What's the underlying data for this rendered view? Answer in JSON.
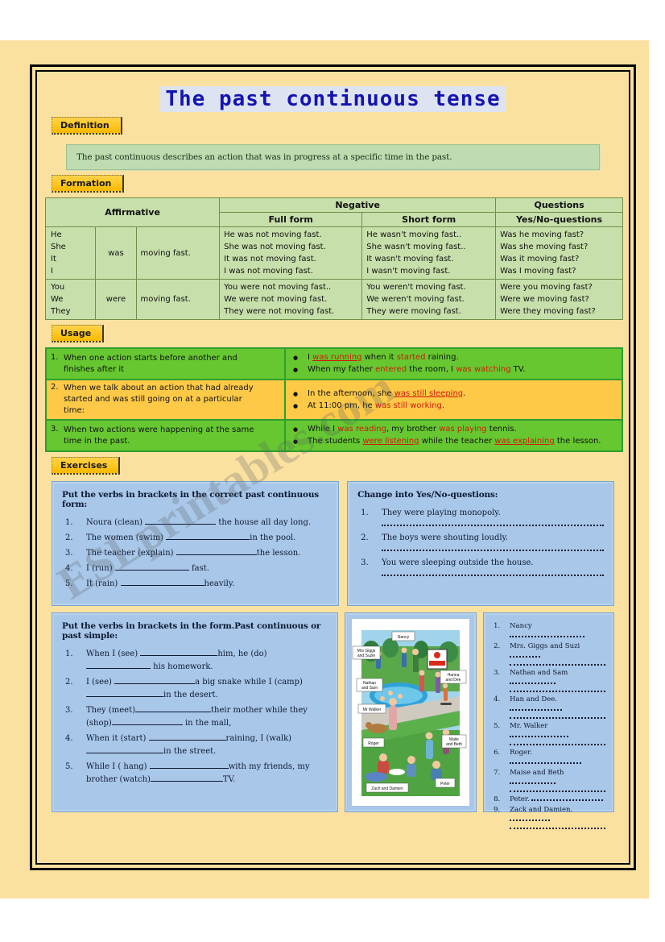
{
  "title": "The past continuous tense",
  "watermark": "ESLprintables.com",
  "sections": {
    "definition_tab": "Definition",
    "formation_tab": "Formation",
    "usage_tab": "Usage",
    "exercises_tab": "Exercises"
  },
  "definition": "The past continuous describes an action that was in progress at a specific time in the past.",
  "formation": {
    "headers": {
      "affirmative": "Affirmative",
      "negative": "Negative",
      "questions": "Questions",
      "full_form": "Full form",
      "short_form": "Short form",
      "yes_no": "Yes/No-questions"
    },
    "rows": [
      {
        "pronouns": "He\nShe\nIt\nI",
        "aux": "was",
        "rest": "moving fast.",
        "full": "He was not moving fast.\nShe was not moving fast.\nIt was not moving fast.\nI was not moving fast.",
        "short": "He wasn't moving fast..\nShe wasn't moving fast..\nIt wasn't moving fast.\nI wasn't moving fast.",
        "question": "Was he moving fast?\nWas she moving fast?\nWas it moving fast?\nWas I moving fast?"
      },
      {
        "pronouns": "You\nWe\nThey",
        "aux": "were",
        "rest": "moving fast.",
        "full": "You were not moving fast..\nWe were not moving fast.\nThey were not moving fast.",
        "short": "You weren't moving fast.\nWe weren't moving fast.\nThey were moving fast.",
        "question": "Were you moving fast?\nWere we moving fast?\nWere they moving fast?"
      }
    ]
  },
  "usage": [
    {
      "num": "1.",
      "rule": "When one action starts before another and finishes after it",
      "examples": [
        [
          {
            "t": "I ",
            "s": "n"
          },
          {
            "t": "was running",
            "s": "pc"
          },
          {
            "t": " when it ",
            "s": "n"
          },
          {
            "t": "started",
            "s": "ps"
          },
          {
            "t": " raining.",
            "s": "n"
          }
        ],
        [
          {
            "t": "When my father ",
            "s": "n"
          },
          {
            "t": "entered",
            "s": "ps"
          },
          {
            "t": " the room, I ",
            "s": "n"
          },
          {
            "t": "was watching",
            "s": "ps"
          },
          {
            "t": " TV.",
            "s": "n"
          }
        ]
      ]
    },
    {
      "num": "2.",
      "rule": "When we talk about an action that had already started and was still going on at a particular time:",
      "examples": [
        [
          {
            "t": "In the afternoon, she ",
            "s": "n"
          },
          {
            "t": "was still sleeping",
            "s": "pc"
          },
          {
            "t": ".",
            "s": "n"
          }
        ],
        [
          {
            "t": "At 11:00 pm, he ",
            "s": "n"
          },
          {
            "t": "was still working",
            "s": "ps"
          },
          {
            "t": ".",
            "s": "n"
          }
        ]
      ]
    },
    {
      "num": "3.",
      "rule": "When two actions were happening at the same time in the past.",
      "examples": [
        [
          {
            "t": "While I ",
            "s": "n"
          },
          {
            "t": "was reading",
            "s": "ps"
          },
          {
            "t": ", my brother ",
            "s": "n"
          },
          {
            "t": "was playing",
            "s": "ps"
          },
          {
            "t": " tennis.",
            "s": "n"
          }
        ],
        [
          {
            "t": "The students ",
            "s": "n"
          },
          {
            "t": "were listening",
            "s": "pc"
          },
          {
            "t": " while the teacher ",
            "s": "n"
          },
          {
            "t": "was explaining",
            "s": "pc"
          },
          {
            "t": " the lesson.",
            "s": "n"
          }
        ]
      ]
    }
  ],
  "exercise1": {
    "heading": "Put the verbs in brackets in the correct past continuous form:",
    "items": [
      {
        "n": "1.",
        "pre": "Noura (clean) ",
        "blank": 88,
        "post": " the house all day long."
      },
      {
        "n": "2.",
        "pre": "The women (swim) ",
        "blank": 104,
        "post": "in the pool."
      },
      {
        "n": "3.",
        "pre": "The teacher (explain) ",
        "blank": 100,
        "post": "the lesson."
      },
      {
        "n": "4.",
        "pre": "I (run) ",
        "blank": 92,
        "post": " fast."
      },
      {
        "n": "5.",
        "pre": "It (rain) ",
        "blank": 104,
        "post": "heavily."
      }
    ]
  },
  "exercise2": {
    "heading": "Change into Yes/No-questions:",
    "items": [
      {
        "n": "1.",
        "text": "They were playing monopoly."
      },
      {
        "n": "2.",
        "text": "The boys were shouting loudly."
      },
      {
        "n": "3.",
        "text": "You were sleeping outside the house."
      }
    ]
  },
  "exercise3": {
    "heading": "Put the verbs in brackets in the form.Past continuous or past simple:",
    "items": [
      {
        "n": "1.",
        "parts": [
          {
            "t": "When I (see) "
          },
          {
            "b": 96
          },
          {
            "t": "him, he (do) "
          },
          {
            "b": 80
          },
          {
            "t": " his homework."
          }
        ]
      },
      {
        "n": "2.",
        "parts": [
          {
            "t": "I (see) "
          },
          {
            "b": 100
          },
          {
            "t": "a big snake while I (camp) "
          },
          {
            "b": 96
          },
          {
            "t": "in the desert."
          }
        ]
      },
      {
        "n": "3.",
        "parts": [
          {
            "t": "They (meet)"
          },
          {
            "b": 94
          },
          {
            "t": "their mother while they (shop)"
          },
          {
            "b": 88
          },
          {
            "t": " in the mall,"
          }
        ]
      },
      {
        "n": "4.",
        "parts": [
          {
            "t": "When it (start) "
          },
          {
            "b": 96
          },
          {
            "t": "raining, I (walk) "
          },
          {
            "b": 96
          },
          {
            "t": "in the street."
          }
        ]
      },
      {
        "n": "5.",
        "parts": [
          {
            "t": "While I ( hang) "
          },
          {
            "b": 98
          },
          {
            "t": "with my friends, my brother (watch)"
          },
          {
            "b": 90
          },
          {
            "t": "TV."
          }
        ]
      }
    ]
  },
  "picture": {
    "alt": "park-scene-illustration",
    "labels": [
      "Nancy",
      "Mrs Giggs and Suzie",
      "Nathan and Sam",
      "Hanna and Dee",
      "Mr Walker",
      "Roger",
      "Maile and Beth",
      "Zach and Damien",
      "Peter"
    ],
    "sign": "NO DIVING"
  },
  "names": {
    "items": [
      {
        "n": "1.",
        "label": "Nancy",
        "wrap": false
      },
      {
        "n": "2.",
        "label": "Mrs. Giggs and Suzi",
        "wrap": true
      },
      {
        "n": "3.",
        "label": "Nathan and Sam",
        "wrap": true
      },
      {
        "n": "4.",
        "label": "Han and Dee.",
        "wrap": true
      },
      {
        "n": "5.",
        "label": "Mr. Walker",
        "wrap": true
      },
      {
        "n": "6.",
        "label": "Roger.",
        "wrap": false
      },
      {
        "n": "7.",
        "label": "Maise and Beth",
        "wrap": true
      },
      {
        "n": "8.",
        "label": "Peter.",
        "wrap": false
      },
      {
        "n": "9.",
        "label": "Zack and Damien.",
        "wrap": true
      }
    ]
  },
  "colors": {
    "page_bg": "#fbe1a0",
    "tab": "#ffc926",
    "definition_bg": "#bfdcb0",
    "table_bg": "#c7dfaa",
    "table_border": "#6f8f4b",
    "usage_green": "#66c730",
    "usage_yellow": "#fdc947",
    "exercise_blue": "#a9c7e8",
    "title_blue": "#1414b4",
    "highlight_red": "#d21a0a"
  }
}
